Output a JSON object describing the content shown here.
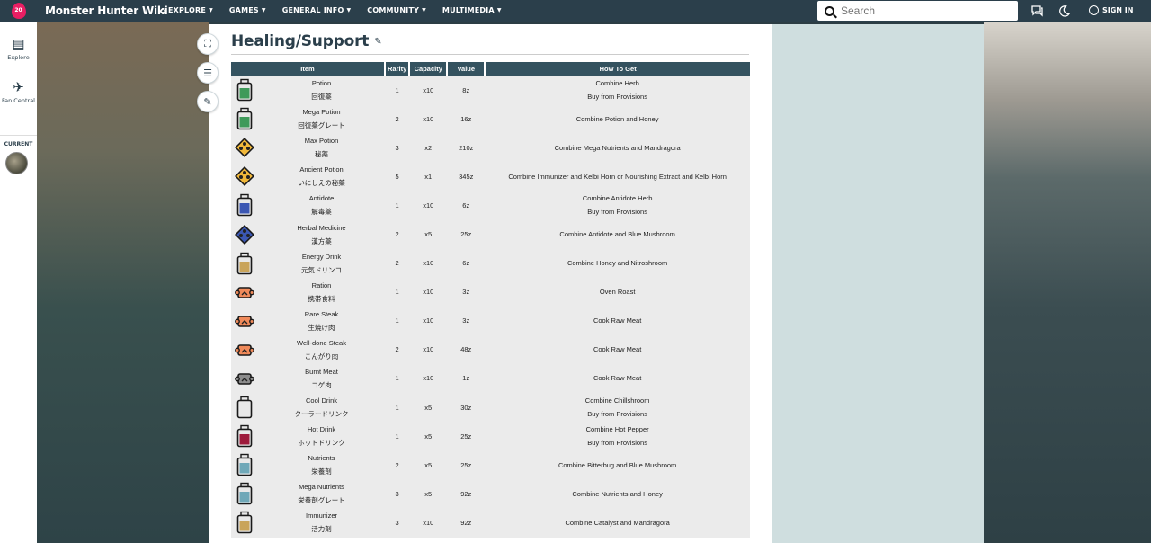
{
  "header": {
    "wiki_name": "Monster Hunter Wiki",
    "nav": [
      "EXPLORE",
      "GAMES",
      "GENERAL INFO",
      "COMMUNITY",
      "MULTIMEDIA"
    ],
    "search_placeholder": "Search",
    "signin_label": "SIGN IN",
    "logo_badge": "20"
  },
  "rail": {
    "explore_label": "Explore",
    "fan_central_label": "Fan Central",
    "current_label": "CURRENT"
  },
  "page": {
    "title": "Healing/Support"
  },
  "table": {
    "headers": [
      "Item",
      "Rarity",
      "Capacity",
      "Value",
      "How To Get"
    ],
    "rows": [
      {
        "name": "Potion",
        "ja": "回復薬",
        "rarity": "1",
        "capacity": "x10",
        "value": "8z",
        "how": [
          "Combine Herb",
          "Buy from Provisions"
        ],
        "icon": "bottle-icon",
        "color": "#3f9a5a"
      },
      {
        "name": "Mega Potion",
        "ja": "回復薬グレート",
        "rarity": "2",
        "capacity": "x10",
        "value": "16z",
        "how": [
          "Combine Potion and Honey"
        ],
        "icon": "bottle-icon",
        "color": "#3f9a5a"
      },
      {
        "name": "Max Potion",
        "ja": "秘薬",
        "rarity": "3",
        "capacity": "x2",
        "value": "210z",
        "how": [
          "Combine Mega Nutrients and Mandragora"
        ],
        "icon": "pill-icon",
        "color": "#f1b83a"
      },
      {
        "name": "Ancient Potion",
        "ja": "いにしえの秘薬",
        "rarity": "5",
        "capacity": "x1",
        "value": "345z",
        "how": [
          "Combine Immunizer and Kelbi Horn or Nourishing Extract and Kelbi Horn"
        ],
        "icon": "pill-icon",
        "color": "#f1b83a"
      },
      {
        "name": "Antidote",
        "ja": "解毒薬",
        "rarity": "1",
        "capacity": "x10",
        "value": "6z",
        "how": [
          "Combine Antidote Herb",
          "Buy from Provisions"
        ],
        "icon": "bottle-icon",
        "color": "#3b57b3"
      },
      {
        "name": "Herbal Medicine",
        "ja": "漢方薬",
        "rarity": "2",
        "capacity": "x5",
        "value": "25z",
        "how": [
          "Combine Antidote and Blue Mushroom"
        ],
        "icon": "pill-icon",
        "color": "#3b57b3"
      },
      {
        "name": "Energy Drink",
        "ja": "元気ドリンコ",
        "rarity": "2",
        "capacity": "x10",
        "value": "6z",
        "how": [
          "Combine Honey and Nitroshroom"
        ],
        "icon": "bottle-icon",
        "color": "#c9a45a"
      },
      {
        "name": "Ration",
        "ja": "携帯食料",
        "rarity": "1",
        "capacity": "x10",
        "value": "3z",
        "how": [
          "Oven Roast"
        ],
        "icon": "meat-icon",
        "color": "#f08a5a"
      },
      {
        "name": "Rare Steak",
        "ja": "生焼け肉",
        "rarity": "1",
        "capacity": "x10",
        "value": "3z",
        "how": [
          "Cook Raw Meat"
        ],
        "icon": "meat-icon",
        "color": "#f08a5a"
      },
      {
        "name": "Well-done Steak",
        "ja": "こんがり肉",
        "rarity": "2",
        "capacity": "x10",
        "value": "48z",
        "how": [
          "Cook Raw Meat"
        ],
        "icon": "meat-icon",
        "color": "#f08a5a"
      },
      {
        "name": "Burnt Meat",
        "ja": "コゲ肉",
        "rarity": "1",
        "capacity": "x10",
        "value": "1z",
        "how": [
          "Cook Raw Meat"
        ],
        "icon": "meat-icon",
        "color": "#8c8c8c"
      },
      {
        "name": "Cool Drink",
        "ja": "クーラードリンク",
        "rarity": "1",
        "capacity": "x5",
        "value": "30z",
        "how": [
          "Combine Chillshroom",
          "Buy from Provisions"
        ],
        "icon": "bottle-icon",
        "color": "#e8e8e8"
      },
      {
        "name": "Hot Drink",
        "ja": "ホットドリンク",
        "rarity": "1",
        "capacity": "x5",
        "value": "25z",
        "how": [
          "Combine Hot Pepper",
          "Buy from Provisions"
        ],
        "icon": "bottle-icon",
        "color": "#9e1b3c"
      },
      {
        "name": "Nutrients",
        "ja": "栄養剤",
        "rarity": "2",
        "capacity": "x5",
        "value": "25z",
        "how": [
          "Combine Bitterbug and Blue Mushroom"
        ],
        "icon": "bottle-icon",
        "color": "#6fa8b8"
      },
      {
        "name": "Mega Nutrients",
        "ja": "栄養剤グレート",
        "rarity": "3",
        "capacity": "x5",
        "value": "92z",
        "how": [
          "Combine Nutrients and Honey"
        ],
        "icon": "bottle-icon",
        "color": "#6fa8b8"
      },
      {
        "name": "Immunizer",
        "ja": "活力剤",
        "rarity": "3",
        "capacity": "x10",
        "value": "92z",
        "how": [
          "Combine Catalyst and Mandragora"
        ],
        "icon": "bottle-icon",
        "color": "#c9a45a"
      }
    ]
  },
  "colors": {
    "header_bg": "#2b3f4b",
    "table_head": "#34525f",
    "row_bg": "#ebebeb",
    "brand": "#e91e63"
  }
}
